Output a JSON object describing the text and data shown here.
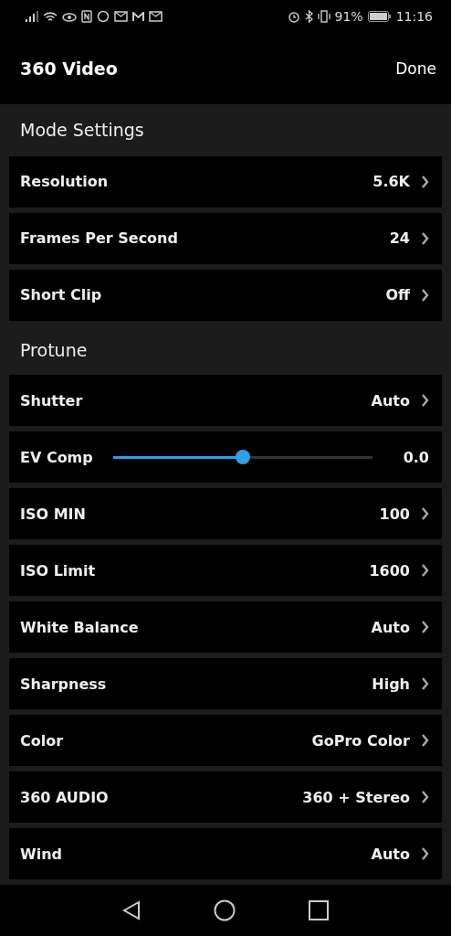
{
  "status_bar": {
    "battery": "91%",
    "time": "11:16"
  },
  "header": {
    "title": "360 Video",
    "done": "Done"
  },
  "sections": [
    {
      "title": "Mode Settings",
      "rows": [
        {
          "kind": "value",
          "label": "Resolution",
          "value": "5.6K"
        },
        {
          "kind": "value",
          "label": "Frames Per Second",
          "value": "24"
        },
        {
          "kind": "value",
          "label": "Short Clip",
          "value": "Off"
        }
      ]
    },
    {
      "title": "Protune",
      "rows": [
        {
          "kind": "value",
          "label": "Shutter",
          "value": "Auto"
        },
        {
          "kind": "slider",
          "label": "EV Comp",
          "level": 0.5,
          "value": "0.0"
        },
        {
          "kind": "value",
          "label": "ISO MIN",
          "value": "100"
        },
        {
          "kind": "value",
          "label": "ISO Limit",
          "value": "1600"
        },
        {
          "kind": "value",
          "label": "White Balance",
          "value": "Auto"
        },
        {
          "kind": "value",
          "label": "Sharpness",
          "value": "High"
        },
        {
          "kind": "value",
          "label": "Color",
          "value": "GoPro Color"
        },
        {
          "kind": "value",
          "label": "360 AUDIO",
          "value": "360 + Stereo"
        },
        {
          "kind": "value",
          "label": "Wind",
          "value": "Auto"
        }
      ]
    }
  ]
}
